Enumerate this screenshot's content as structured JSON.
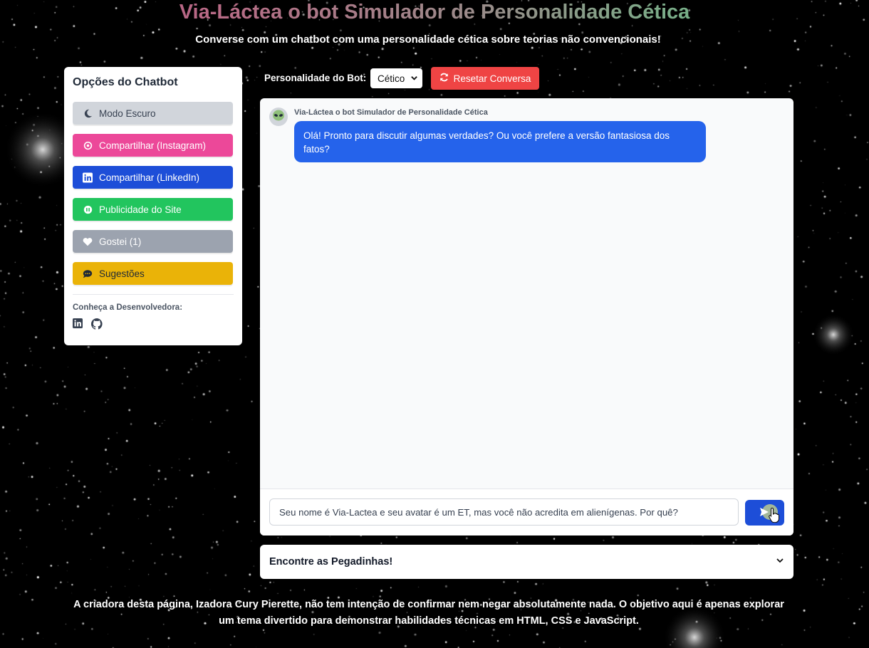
{
  "header": {
    "title": "Via-Láctea o bot Simulador de Personalidade Cética",
    "subtitle": "Converse com um chatbot com uma personalidade cética sobre teorias não convencionais!"
  },
  "sidebar": {
    "heading": "Opções do Chatbot",
    "buttons": [
      {
        "label": "Modo Escuro",
        "icon": "moon-icon",
        "color": "#d1d5db"
      },
      {
        "label": "Compartilhar (Instagram)",
        "icon": "instagram-icon",
        "color": "#ec4899"
      },
      {
        "label": "Compartilhar (LinkedIn)",
        "icon": "linkedin-icon",
        "color": "#1d4ed8"
      },
      {
        "label": "Publicidade do Site",
        "icon": "ad-icon",
        "color": "#22c55e"
      },
      {
        "label": "Gostei (1)",
        "icon": "heart-icon",
        "color": "#9ca3af"
      },
      {
        "label": "Sugestões",
        "icon": "comment-icon",
        "color": "#eab308"
      }
    ],
    "developer_label": "Conheça a Desenvolvedora:"
  },
  "controls": {
    "personality_label": "Personalidade do Bot:",
    "personality_value": "Cético",
    "reset_label": "Resetar Conversa"
  },
  "chat": {
    "bot_name": "Via-Láctea o bot Simulador de Personalidade Cética",
    "messages": [
      {
        "sender": "bot",
        "text": "Olá! Pronto para discutir algumas verdades? Ou você prefere a versão fantasiosa dos fatos?"
      }
    ],
    "input_value": "Seu nome é Via-Lactea e seu avatar é um ET, mas você não acredita em alienígenas. Por quê?"
  },
  "accordion": {
    "label": "Encontre as Pegadinhas!"
  },
  "footer": {
    "line1": "A criadora desta página, Izadora Cury Pierette, não tem intenção de confirmar nem negar absolutamente nada. O objetivo aqui é apenas explorar",
    "line2": "um tema divertido para demonstrar habilidades técnicas em HTML, CSS e JavaScript."
  },
  "colors": {
    "accent_blue": "#2563eb",
    "reset_red": "#ef4444",
    "background": "#000000"
  }
}
